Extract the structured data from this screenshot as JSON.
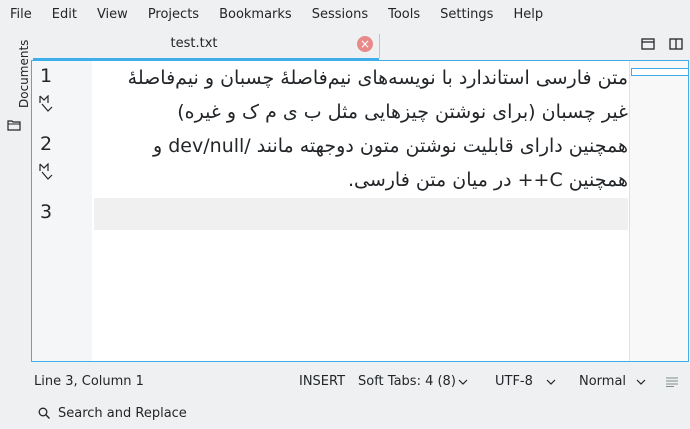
{
  "menu": [
    "File",
    "Edit",
    "View",
    "Projects",
    "Bookmarks",
    "Sessions",
    "Tools",
    "Settings",
    "Help"
  ],
  "sidebar": {
    "documents_label": "Documents"
  },
  "tab": {
    "title": "test.txt",
    "close": "×"
  },
  "editor": {
    "line_numbers": [
      "1",
      "2",
      "3"
    ],
    "lines": [
      "متن فارسی استاندارد با نویسه‌های نیم‌فاصلهٔ چسبان و نیم‌فاصلهٔ",
      "غیر چسبان (برای نوشتن چیزهایی مثل ب‌ ی‌ م‌ ک‌ و غیره)",
      "همچنین دارای قابلیت نوشتن متون دوجهته مانند /dev/null و",
      "همچنین C++ در میان متن فارسی."
    ]
  },
  "status": {
    "position": "Line 3, Column 1",
    "mode": "INSERT",
    "indent": "Soft Tabs: 4 (8)",
    "encoding": "UTF-8",
    "input_mode": "Normal"
  },
  "search": {
    "label": "Search and Replace"
  }
}
